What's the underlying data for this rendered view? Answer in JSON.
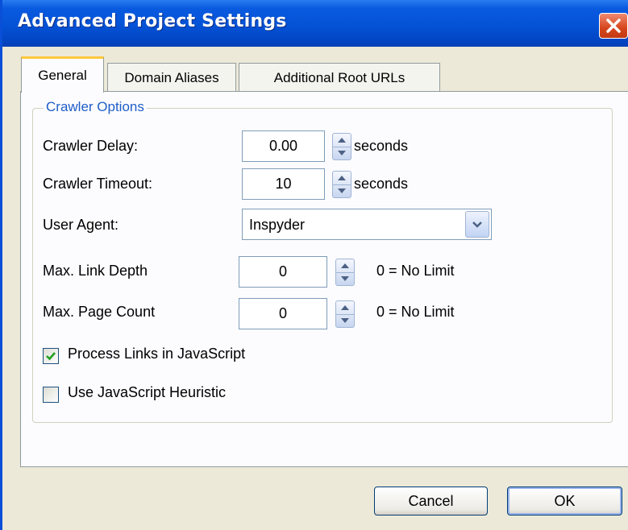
{
  "window": {
    "title": "Advanced Project Settings",
    "close_icon": "close-x-icon",
    "title_bar_color": "#0452d6",
    "background_color": "#ece9d8"
  },
  "tabs": [
    {
      "label": "General",
      "active": true
    },
    {
      "label": "Domain Aliases",
      "active": false
    },
    {
      "label": "Additional Root URLs",
      "active": false
    }
  ],
  "crawler_options": {
    "legend": "Crawler Options",
    "crawler_delay": {
      "label": "Crawler Delay:",
      "value": "0.00",
      "unit": "seconds"
    },
    "crawler_timeout": {
      "label": "Crawler Timeout:",
      "value": "10",
      "unit": "seconds"
    },
    "user_agent": {
      "label": "User Agent:",
      "value": "Inspyder"
    },
    "max_link_depth": {
      "label": "Max. Link Depth",
      "value": "0",
      "hint": "0 = No Limit"
    },
    "max_page_count": {
      "label": "Max. Page Count",
      "value": "0",
      "hint": "0 = No Limit"
    },
    "process_links_js": {
      "label": "Process Links in JavaScript",
      "checked": true
    },
    "use_js_heuristic": {
      "label": "Use JavaScript Heuristic",
      "checked": false
    }
  },
  "buttons": {
    "cancel": "Cancel",
    "ok": "OK"
  }
}
